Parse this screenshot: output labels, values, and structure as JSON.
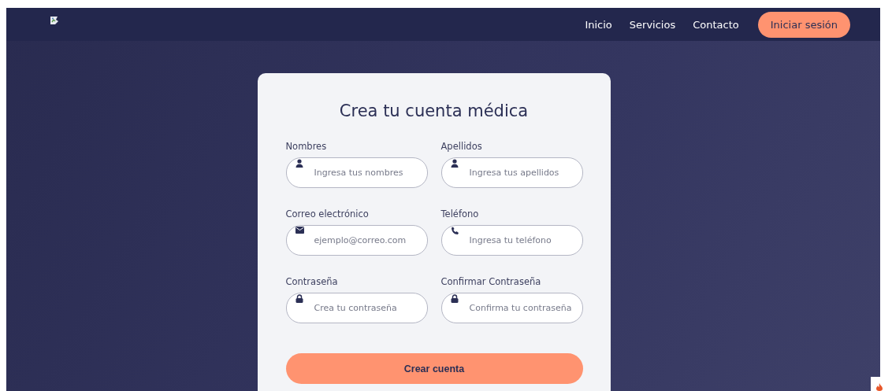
{
  "nav": {
    "links": [
      {
        "label": "Inicio"
      },
      {
        "label": "Servicios"
      },
      {
        "label": "Contacto"
      }
    ],
    "login": "Iniciar sesión"
  },
  "form": {
    "title": "Crea tu cuenta médica",
    "fields": [
      {
        "label": "Nombres",
        "placeholder": "Ingresa tus nombres",
        "kind": "person"
      },
      {
        "label": "Apellidos",
        "placeholder": "Ingresa tus apellidos",
        "kind": "person"
      },
      {
        "label": "Correo electrónico",
        "placeholder": "ejemplo@correo.com",
        "kind": "email"
      },
      {
        "label": "Teléfono",
        "placeholder": "Ingresa tu teléfono",
        "kind": "phone"
      },
      {
        "label": "Contraseña",
        "placeholder": "Crea tu contraseña",
        "kind": "password"
      },
      {
        "label": "Confirmar Contraseña",
        "placeholder": "Confirma tu contraseña",
        "kind": "password"
      }
    ],
    "submit": "Crear cuenta"
  }
}
